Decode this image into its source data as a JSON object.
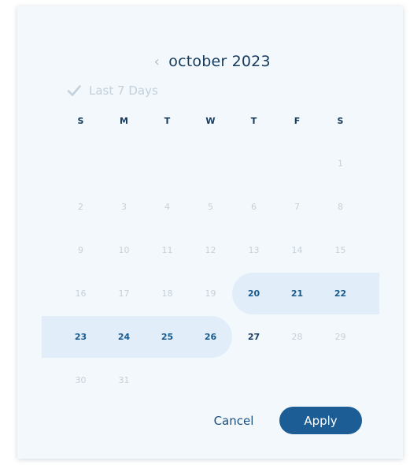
{
  "header": {
    "prev_icon": "chevron-left-icon",
    "month_title": "october 2023"
  },
  "quick_range": {
    "label": "Last 7 Days",
    "checked": true,
    "icon": "checkmark-icon"
  },
  "weekdays": [
    "S",
    "M",
    "T",
    "W",
    "T",
    "F",
    "S"
  ],
  "weeks": [
    [
      "",
      "",
      "",
      "",
      "",
      "",
      "1"
    ],
    [
      "2",
      "3",
      "4",
      "5",
      "6",
      "7",
      "8"
    ],
    [
      "9",
      "10",
      "11",
      "12",
      "13",
      "14",
      "15"
    ],
    [
      "16",
      "17",
      "18",
      "19",
      "20",
      "21",
      "22"
    ],
    [
      "23",
      "24",
      "25",
      "26",
      "27",
      "28",
      "29"
    ],
    [
      "30",
      "31",
      "",
      "",
      "",
      "",
      ""
    ]
  ],
  "selected_range": {
    "start": "20",
    "end": "26"
  },
  "selectable_days": [
    "27"
  ],
  "footer": {
    "cancel_label": "Cancel",
    "apply_label": "Apply"
  },
  "colors": {
    "panel_background": "#f3f8fc",
    "range_highlight": "#e1eef9",
    "accent": "#1d5d95",
    "text_dark": "#163a5c",
    "text_disabled": "#c7d0d8"
  }
}
